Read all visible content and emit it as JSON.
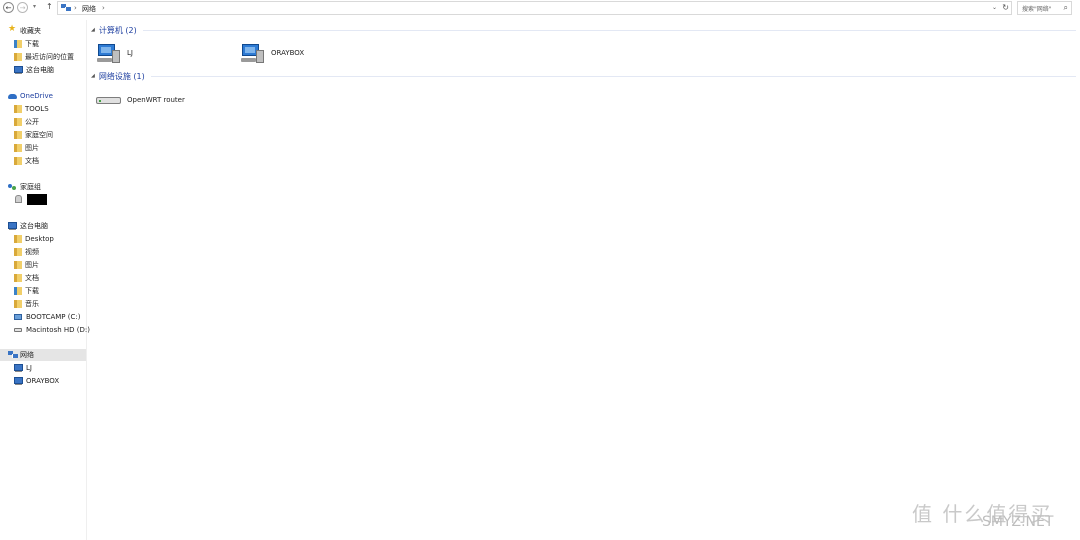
{
  "address_bar": {
    "back_icon": "arrow-left-icon",
    "forward_icon": "arrow-right-icon",
    "breadcrumb": "网络",
    "separator": "›",
    "search_placeholder": "搜索\"网络\""
  },
  "nav": {
    "favorites": {
      "label": "收藏夹",
      "items": [
        "下载",
        "最近访问的位置",
        "这台电脑"
      ]
    },
    "onedrive": {
      "label": "OneDrive",
      "items": [
        "TOOLS",
        "公开",
        "家庭空间",
        "图片",
        "文档"
      ]
    },
    "homegroup": {
      "label": "家庭组"
    },
    "this_pc": {
      "label": "这台电脑",
      "items": [
        "Desktop",
        "视频",
        "图片",
        "文档",
        "下载",
        "音乐",
        "BOOTCAMP (C:)",
        "Macintosh HD (D:)"
      ]
    },
    "network": {
      "label": "网络",
      "items": [
        "LJ",
        "ORAYBOX"
      ]
    }
  },
  "content": {
    "groups": [
      {
        "title": "计算机 (2)",
        "items": [
          "LJ",
          "ORAYBOX"
        ]
      },
      {
        "title": "网络设施 (1)",
        "items": [
          "OpenWRT router"
        ]
      }
    ]
  },
  "watermark": {
    "cn": "值 什么值得买",
    "en": "SMYZ.NET"
  }
}
